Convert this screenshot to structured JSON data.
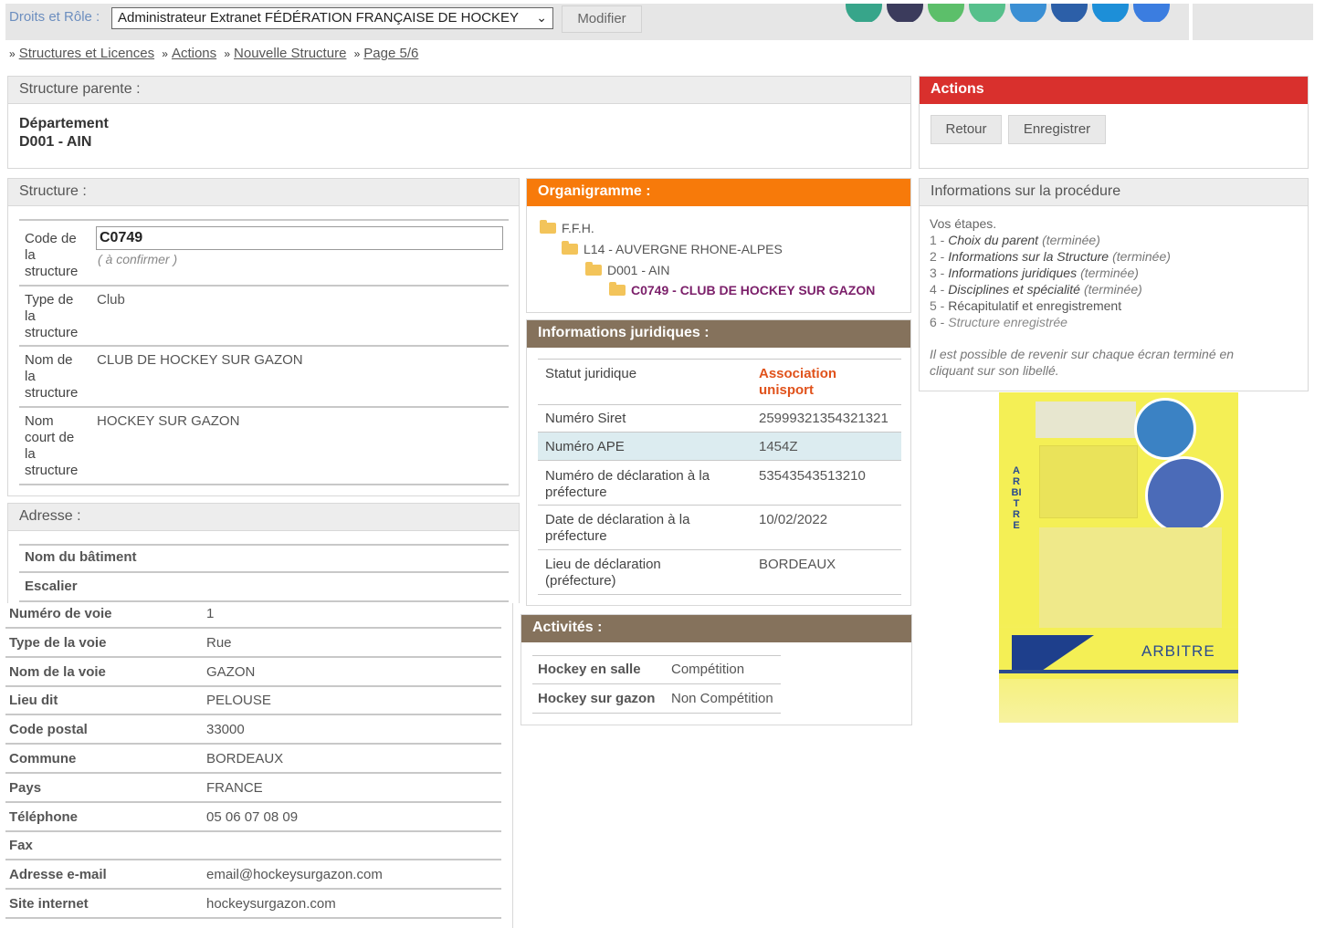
{
  "topbar": {
    "role_label": "Droits et Rôle :",
    "role_value": "Administrateur Extranet FÉDÉRATION FRANÇAISE DE HOCKEY",
    "modify_label": "Modifier"
  },
  "breadcrumb": {
    "items": [
      "Structures et Licences",
      "Actions",
      "Nouvelle Structure",
      "Page 5/6"
    ]
  },
  "parent": {
    "title": "Structure parente :",
    "line1": "Département",
    "line2": "D001 - AIN"
  },
  "actions": {
    "title": "Actions",
    "back": "Retour",
    "save": "Enregistrer"
  },
  "structure": {
    "title": "Structure :",
    "code_label": "Code de\nla\nstructure",
    "code_value": "C0749",
    "code_hint": "( à confirmer )",
    "type_label": "Type de\nla\nstructure",
    "type_value": "Club",
    "name_label": "Nom de\nla\nstructure",
    "name_value": "CLUB DE HOCKEY SUR GAZON",
    "short_label": "Nom\ncourt de\nla\nstructure",
    "short_value": "HOCKEY SUR GAZON"
  },
  "address": {
    "title": "Adresse :",
    "building_label": "Nom du bâtiment",
    "stair_label": "Escalier",
    "rows": [
      {
        "label": "Numéro de voie",
        "value": "1"
      },
      {
        "label": "Type de la voie",
        "value": "Rue"
      },
      {
        "label": "Nom de la voie",
        "value": "GAZON"
      },
      {
        "label": "Lieu dit",
        "value": "PELOUSE"
      },
      {
        "label": "Code postal",
        "value": "33000"
      },
      {
        "label": "Commune",
        "value": "BORDEAUX"
      },
      {
        "label": "Pays",
        "value": "FRANCE"
      },
      {
        "label": "Téléphone",
        "value": "05 06 07 08 09"
      },
      {
        "label": "Fax",
        "value": ""
      },
      {
        "label": "Adresse e-mail",
        "value": "email@hockeysurgazon.com"
      },
      {
        "label": "Site internet",
        "value": "hockeysurgazon.com"
      }
    ]
  },
  "org": {
    "title": "Organigramme :",
    "level1": "F.F.H.",
    "level2": "L14 - AUVERGNE RHONE-ALPES",
    "level3": "D001 - AIN",
    "level4": "C0749 - CLUB DE HOCKEY SUR GAZON"
  },
  "legal": {
    "title": "Informations juridiques :",
    "statut_label": "Statut juridique",
    "statut_value": "Association\nunisport",
    "siret_label": "Numéro Siret",
    "siret_value": "25999321354321321",
    "ape_label": "Numéro APE",
    "ape_value": "1454Z",
    "decl_label": "Numéro de déclaration à la\npréfecture",
    "decl_value": "53543543513210",
    "date_label": "Date de déclaration à la\npréfecture",
    "date_value": "10/02/2022",
    "place_label": "Lieu de déclaration\n(préfecture)",
    "place_value": "BORDEAUX"
  },
  "activities": {
    "title": "Activités :",
    "rows": [
      {
        "label": "Hockey en salle",
        "value": "Compétition"
      },
      {
        "label": "Hockey sur gazon",
        "value": "Non Compétition"
      }
    ]
  },
  "procedure": {
    "title": "Informations sur la procédure",
    "intro": "Vos étapes.",
    "steps": [
      {
        "num": "1 - ",
        "label": "Choix du parent",
        "state": "(terminée)"
      },
      {
        "num": "2 - ",
        "label": "Informations sur la Structure",
        "state": "(terminée)"
      },
      {
        "num": "3 - ",
        "label": "Informations juridiques",
        "state": "(terminée)"
      },
      {
        "num": "4 - ",
        "label": "Disciplines et spécialité",
        "state": "(terminée)"
      },
      {
        "num": "5 - ",
        "label": "Récapitulatif et enregistrement",
        "state": ""
      },
      {
        "num": "6 - ",
        "label": "Structure enregistrée",
        "state": ""
      }
    ],
    "note": "Il est possible de revenir sur chaque écran terminé en\ncliquant sur son libellé."
  },
  "poster": {
    "vertical": "ARBITRE",
    "footer": "ARBITRE"
  },
  "colors": {
    "red": "#d9302d",
    "orange": "#f77a0a",
    "brown": "#85725c",
    "statut_value": "#e0521b",
    "active_org": "#7b1f6a"
  }
}
